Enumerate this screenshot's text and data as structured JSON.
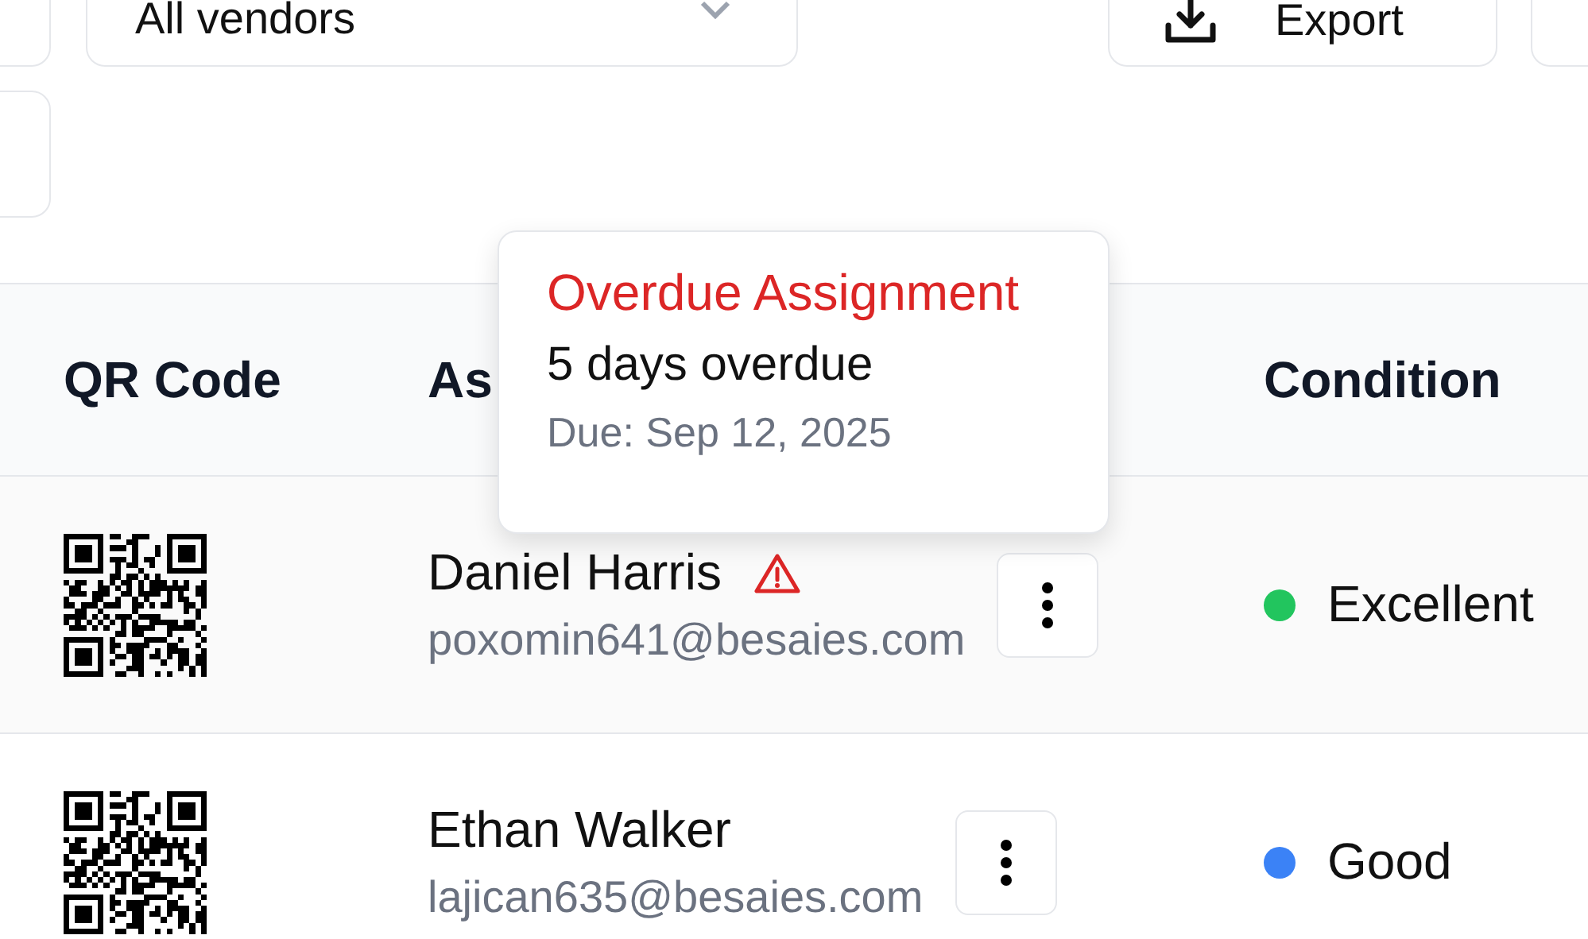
{
  "toolbar": {
    "vendor_filter": {
      "value": "All vendors"
    },
    "export_button": {
      "label": "Export"
    }
  },
  "table": {
    "columns": [
      "QR Code",
      "As",
      "Condition"
    ],
    "rows": [
      {
        "name": "Daniel Harris",
        "email": "poxomin641@besaies.com",
        "overdue": true,
        "condition": "Excellent",
        "color": "#22c55e"
      },
      {
        "name": "Ethan Walker",
        "email": "lajican635@besaies.com",
        "overdue": false,
        "condition": "Good",
        "color": "#3b82f6"
      }
    ]
  },
  "tooltip": {
    "title": "Overdue Assignment",
    "message": "5 days overdue",
    "due": "Due: Sep 12, 2025"
  }
}
